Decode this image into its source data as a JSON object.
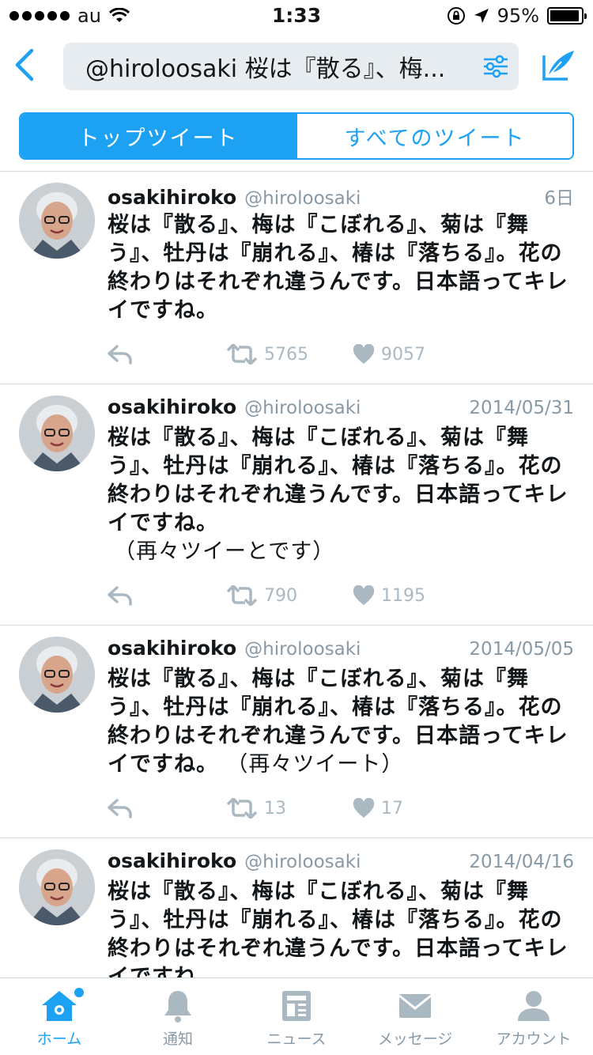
{
  "status_bar": {
    "carrier": "au",
    "time": "1:33",
    "battery_text": "95%",
    "battery_level": 0.95
  },
  "nav": {
    "search_text": "@hiroloosaki 桜は『散る』、梅..."
  },
  "segments": {
    "top": "トップツイート",
    "all": "すべてのツイート"
  },
  "tweets": [
    {
      "name": "osakihiroko",
      "handle": "@hiroloosaki",
      "date": "6日",
      "text": "桜は『散る』、梅は『こぼれる』、菊は『舞う』、牡丹は『崩れる』、椿は『落ちる』。花の終わりはそれぞれ違うんです。日本語ってキレイですね。",
      "extra": "",
      "retweets": "5765",
      "likes": "9057"
    },
    {
      "name": "osakihiroko",
      "handle": "@hiroloosaki",
      "date": "2014/05/31",
      "text": "桜は『散る』、梅は『こぼれる』、菊は『舞う』、牡丹は『崩れる』、椿は『落ちる』。花の終わりはそれぞれ違うんです。日本語ってキレイですね。",
      "extra": "（再々ツイーとです）",
      "retweets": "790",
      "likes": "1195"
    },
    {
      "name": "osakihiroko",
      "handle": "@hiroloosaki",
      "date": "2014/05/05",
      "text": "桜は『散る』、梅は『こぼれる』、菊は『舞う』、牡丹は『崩れる』、椿は『落ちる』。花の終わりはそれぞれ違うんです。日本語ってキレイですね。",
      "extra": "（再々ツイート）",
      "retweets": "13",
      "likes": "17"
    },
    {
      "name": "osakihiroko",
      "handle": "@hiroloosaki",
      "date": "2014/04/16",
      "text": "桜は『散る』、梅は『こぼれる』、菊は『舞う』、牡丹は『崩れる』、椿は『落ちる』。花の終わりはそれぞれ違うんです。日本語ってキレイですね。",
      "extra": "",
      "retweets": "",
      "likes": ""
    }
  ],
  "tabs": {
    "home": "ホーム",
    "notifications": "通知",
    "news": "ニュース",
    "messages": "メッセージ",
    "account": "アカウント"
  },
  "colors": {
    "accent": "#1da1f2",
    "muted": "#8899a6",
    "icon_gray": "#aab8c2"
  }
}
